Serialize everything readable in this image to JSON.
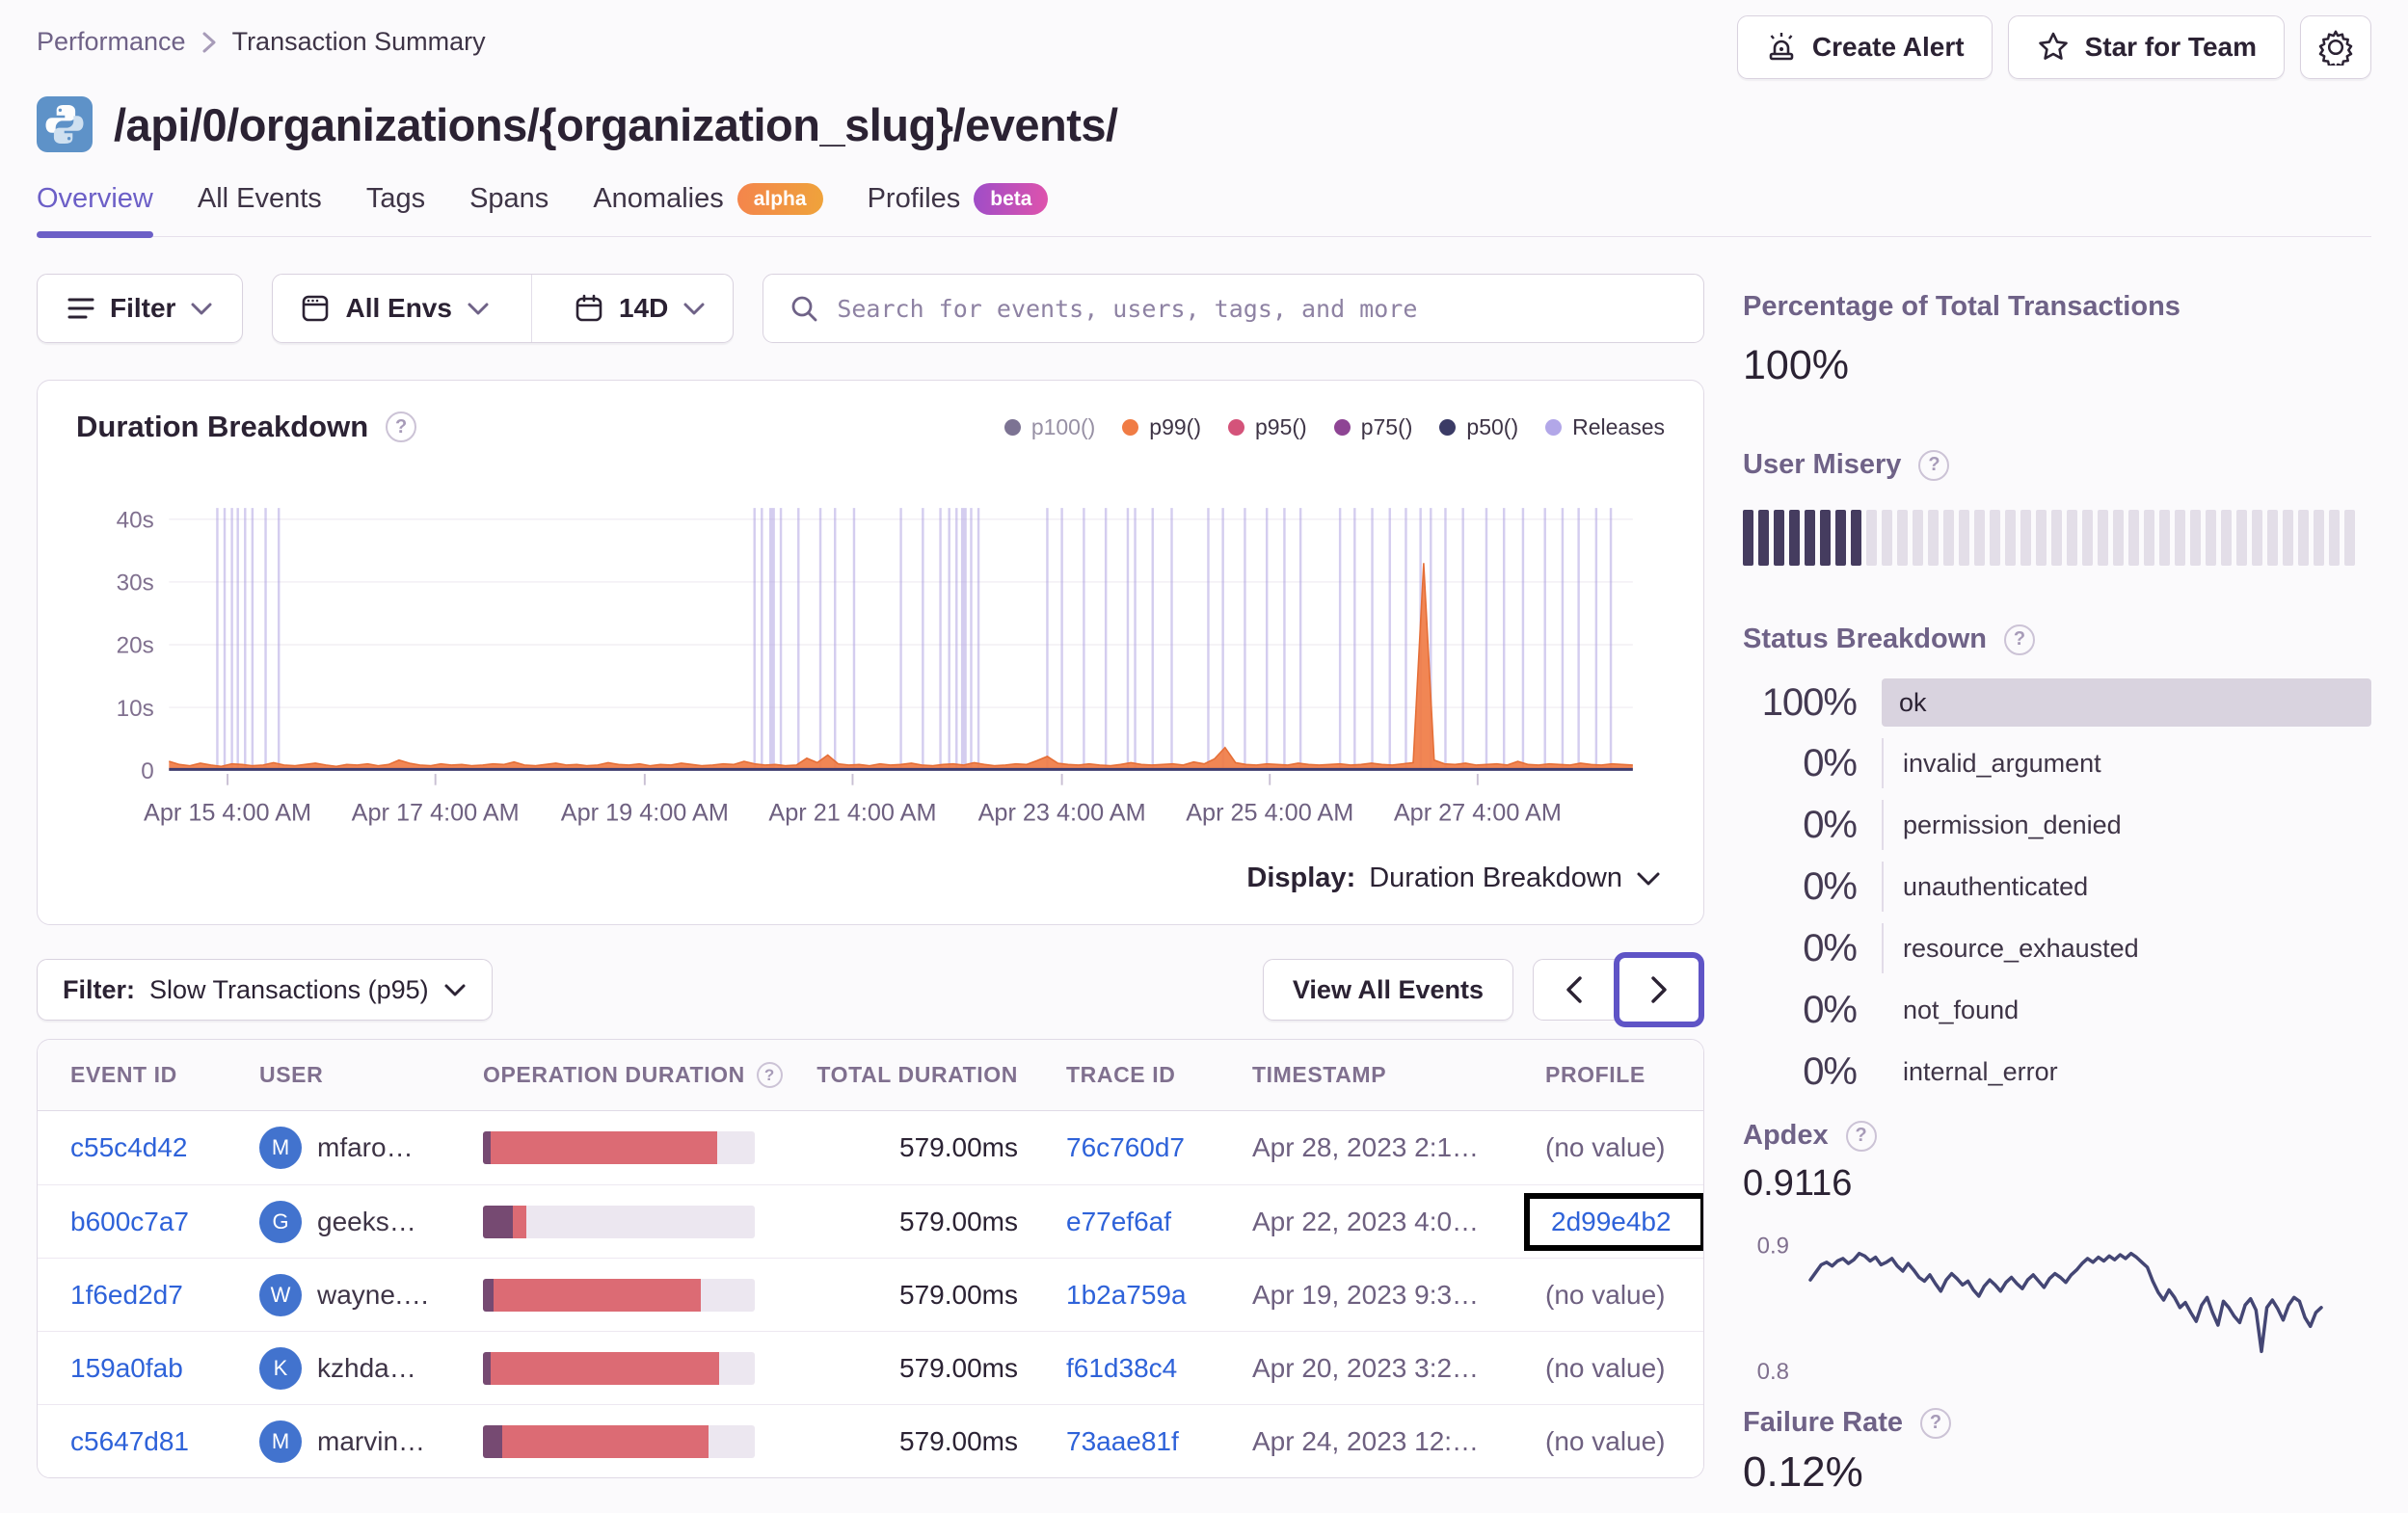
{
  "breadcrumb": {
    "section": "Performance",
    "page": "Transaction Summary"
  },
  "header": {
    "title": "/api/0/organizations/{organization_slug}/events/",
    "actions": {
      "create_alert": "Create Alert",
      "star": "Star for Team"
    }
  },
  "tabs": [
    {
      "label": "Overview",
      "active": true
    },
    {
      "label": "All Events"
    },
    {
      "label": "Tags"
    },
    {
      "label": "Spans"
    },
    {
      "label": "Anomalies",
      "badge": "alpha"
    },
    {
      "label": "Profiles",
      "badge": "beta"
    }
  ],
  "filters": {
    "filter_label": "Filter",
    "environment": "All Envs",
    "date_range": "14D",
    "search_placeholder": "Search for events, users, tags, and more"
  },
  "display_row": {
    "label": "Display:",
    "value": "Duration Breakdown"
  },
  "table_controls": {
    "filter_label": "Filter:",
    "filter_value": "Slow Transactions (p95)",
    "view_all": "View All Events"
  },
  "table": {
    "columns": [
      {
        "label": "EVENT ID"
      },
      {
        "label": "USER"
      },
      {
        "label": "OPERATION DURATION",
        "help": true
      },
      {
        "label": "TOTAL DURATION",
        "align": "right"
      },
      {
        "label": "TRACE ID"
      },
      {
        "label": "TIMESTAMP"
      },
      {
        "label": "PROFILE"
      }
    ],
    "rows": [
      {
        "event_id": "c55c4d42",
        "avatar": "M",
        "user": "mfaro…",
        "bar_purple": 3,
        "bar_red": 83,
        "total": "579.00ms",
        "trace": "76c760d7",
        "timestamp": "Apr 28, 2023 2:1…",
        "profile": "(no value)",
        "profile_link": false,
        "highlighted": false
      },
      {
        "event_id": "b600c7a7",
        "avatar": "G",
        "user": "geeks…",
        "bar_purple": 11,
        "bar_red": 5,
        "total": "579.00ms",
        "trace": "e77ef6af",
        "timestamp": "Apr 22, 2023 4:0…",
        "profile": "2d99e4b2",
        "profile_link": true,
        "highlighted": true
      },
      {
        "event_id": "1f6ed2d7",
        "avatar": "W",
        "user": "wayne.…",
        "bar_purple": 4,
        "bar_red": 76,
        "total": "579.00ms",
        "trace": "1b2a759a",
        "timestamp": "Apr 19, 2023 9:3…",
        "profile": "(no value)",
        "profile_link": false,
        "highlighted": false
      },
      {
        "event_id": "159a0fab",
        "avatar": "K",
        "user": "kzhda…",
        "bar_purple": 3,
        "bar_red": 84,
        "total": "579.00ms",
        "trace": "f61d38c4",
        "timestamp": "Apr 20, 2023 3:2…",
        "profile": "(no value)",
        "profile_link": false,
        "highlighted": false
      },
      {
        "event_id": "c5647d81",
        "avatar": "M",
        "user": "marvin…",
        "bar_purple": 7,
        "bar_red": 76,
        "total": "579.00ms",
        "trace": "73aae81f",
        "timestamp": "Apr 24, 2023 12:…",
        "profile": "(no value)",
        "profile_link": false,
        "highlighted": false
      }
    ]
  },
  "sidebar": {
    "total_transactions": {
      "title": "Percentage of Total Transactions",
      "value": "100%"
    },
    "user_misery": {
      "title": "User Misery",
      "total_segments": 40,
      "filled_segments": 8,
      "filled_color": "#453C5F",
      "empty_color": "#E3DEE8"
    },
    "status_breakdown": {
      "title": "Status Breakdown",
      "rows": [
        {
          "percent": "100%",
          "label": "ok",
          "bar": true,
          "line": false
        },
        {
          "percent": "0%",
          "label": "invalid_argument",
          "bar": false,
          "line": true
        },
        {
          "percent": "0%",
          "label": "permission_denied",
          "bar": false,
          "line": true
        },
        {
          "percent": "0%",
          "label": "unauthenticated",
          "bar": false,
          "line": true
        },
        {
          "percent": "0%",
          "label": "resource_exhausted",
          "bar": false,
          "line": true
        },
        {
          "percent": "0%",
          "label": "not_found",
          "bar": false,
          "line": false
        },
        {
          "percent": "0%",
          "label": "internal_error",
          "bar": false,
          "line": false
        }
      ]
    },
    "apdex": {
      "title": "Apdex",
      "value": "0.9116"
    },
    "failure_rate": {
      "title": "Failure Rate",
      "value": "0.12%"
    }
  },
  "colors": {
    "accent": "#6C5FC7",
    "link": "#2E62D9",
    "bar_red": "#DC6B74",
    "bar_purple": "#764A72",
    "bar_empty": "#ECE7F0",
    "area_orange": "#F07C45",
    "p50_line": "#3F3C6E",
    "release_line": "rgba(169,156,224,0.5)",
    "grid": "#F2EFF4",
    "baseline": "#E4DFE8",
    "axis_text": "#80708F",
    "spark_line": "#444674"
  },
  "chart_data": [
    {
      "type": "area",
      "title": "Duration Breakdown",
      "ylabel": "duration",
      "ylim": [
        0,
        40
      ],
      "y_ticks": [
        0,
        10,
        20,
        30,
        40
      ],
      "y_tick_labels": [
        "0",
        "10s",
        "20s",
        "30s",
        "40s"
      ],
      "x_tick_labels": [
        "Apr 15 4:00 AM",
        "Apr 17 4:00 AM",
        "Apr 19 4:00 AM",
        "Apr 21 4:00 AM",
        "Apr 23 4:00 AM",
        "Apr 25 4:00 AM",
        "Apr 27 4:00 AM"
      ],
      "x_tick_fractions": [
        0.04,
        0.182,
        0.325,
        0.467,
        0.61,
        0.752,
        0.894
      ],
      "grid": true,
      "legend_position": "top-right",
      "legend": [
        {
          "label": "p100()",
          "color": "#7C7393",
          "muted": true
        },
        {
          "label": "p99()",
          "color": "#F07C45",
          "muted": false
        },
        {
          "label": "p95()",
          "color": "#D4537A",
          "muted": false
        },
        {
          "label": "p75()",
          "color": "#8E4594",
          "muted": false
        },
        {
          "label": "p50()",
          "color": "#3B3B66",
          "muted": false
        },
        {
          "label": "Releases",
          "color": "#B2A7E8",
          "muted": false
        }
      ],
      "series": [
        {
          "name": "p99()",
          "unit": "s",
          "values": [
            1.4,
            0.9,
            0.7,
            1.1,
            0.8,
            0.6,
            1.0,
            0.9,
            0.7,
            0.8,
            1.2,
            0.8,
            0.7,
            0.9,
            1.1,
            0.8,
            0.6,
            0.9,
            0.8,
            1.0,
            0.7,
            0.9,
            1.6,
            1.1,
            0.8,
            0.7,
            1.0,
            0.8,
            0.9,
            0.7,
            0.8,
            1.0,
            0.9,
            1.3,
            0.8,
            0.7,
            0.9,
            1.1,
            0.8,
            0.9,
            0.7,
            0.8,
            1.2,
            0.9,
            0.8,
            1.0,
            0.7,
            0.9,
            0.8,
            1.1,
            0.9,
            0.7,
            0.8,
            1.0,
            0.9,
            1.4,
            1.0,
            0.8,
            0.9,
            0.7,
            0.8,
            1.9,
            1.2,
            2.4,
            1.0,
            0.8,
            0.9,
            0.7,
            1.0,
            0.8,
            0.9,
            1.1,
            0.8,
            0.7,
            0.9,
            1.0,
            0.8,
            1.2,
            0.9,
            0.7,
            0.8,
            1.0,
            0.9,
            1.5,
            2.2,
            1.1,
            0.9,
            0.8,
            1.0,
            0.8,
            0.7,
            0.9,
            1.2,
            0.9,
            0.8,
            0.9,
            1.0,
            0.8,
            1.3,
            1.0,
            1.8,
            3.6,
            1.2,
            0.9,
            0.8,
            1.0,
            0.9,
            0.8,
            1.1,
            0.9,
            0.8,
            0.9,
            1.0,
            0.8,
            0.9,
            1.1,
            0.9,
            0.8,
            1.0,
            1.2,
            33.0,
            1.6,
            1.0,
            0.9,
            1.1,
            0.8,
            0.9,
            1.0,
            0.8,
            1.4,
            0.9,
            0.8,
            1.0,
            0.9,
            0.8,
            1.1,
            0.9,
            0.8,
            1.0,
            0.9,
            0.8
          ]
        },
        {
          "name": "p50()",
          "unit": "s",
          "constant_value": 0.12
        }
      ],
      "release_lines": [
        0.033,
        0.038,
        0.043,
        0.047,
        0.052,
        0.057,
        0.066,
        0.075,
        0.4,
        0.405,
        0.412,
        0.418,
        0.43,
        0.445,
        0.455,
        0.468,
        0.5,
        0.515,
        0.527,
        0.533,
        0.538,
        0.543,
        0.548,
        0.553,
        0.6,
        0.61,
        0.625,
        0.64,
        0.655,
        0.66,
        0.672,
        0.685,
        0.71,
        0.72,
        0.735,
        0.75,
        0.762,
        0.773,
        0.8,
        0.81,
        0.822,
        0.834,
        0.845,
        0.855,
        0.862,
        0.872,
        0.884,
        0.9,
        0.912,
        0.925,
        0.94,
        0.952,
        0.963,
        0.975,
        0.985
      ],
      "release_lines_wide": [
        0.412,
        0.543
      ]
    },
    {
      "type": "line",
      "title": "Apdex trend",
      "ylim": [
        0.8,
        0.915
      ],
      "y_tick_labels": [
        "0.9",
        "0.8"
      ],
      "grid": false,
      "values": [
        0.872,
        0.878,
        0.884,
        0.886,
        0.883,
        0.887,
        0.889,
        0.885,
        0.888,
        0.893,
        0.891,
        0.887,
        0.89,
        0.884,
        0.886,
        0.889,
        0.883,
        0.879,
        0.885,
        0.88,
        0.874,
        0.871,
        0.876,
        0.869,
        0.863,
        0.872,
        0.877,
        0.873,
        0.868,
        0.871,
        0.864,
        0.859,
        0.867,
        0.872,
        0.868,
        0.863,
        0.87,
        0.874,
        0.869,
        0.865,
        0.872,
        0.876,
        0.871,
        0.866,
        0.873,
        0.877,
        0.874,
        0.87,
        0.876,
        0.88,
        0.885,
        0.889,
        0.886,
        0.89,
        0.887,
        0.891,
        0.888,
        0.892,
        0.889,
        0.893,
        0.89,
        0.886,
        0.882,
        0.871,
        0.862,
        0.856,
        0.864,
        0.858,
        0.85,
        0.854,
        0.846,
        0.839,
        0.852,
        0.858,
        0.846,
        0.836,
        0.855,
        0.85,
        0.843,
        0.838,
        0.852,
        0.857,
        0.848,
        0.815,
        0.85,
        0.856,
        0.849,
        0.84,
        0.852,
        0.858,
        0.855,
        0.842,
        0.835,
        0.846,
        0.85
      ]
    }
  ]
}
